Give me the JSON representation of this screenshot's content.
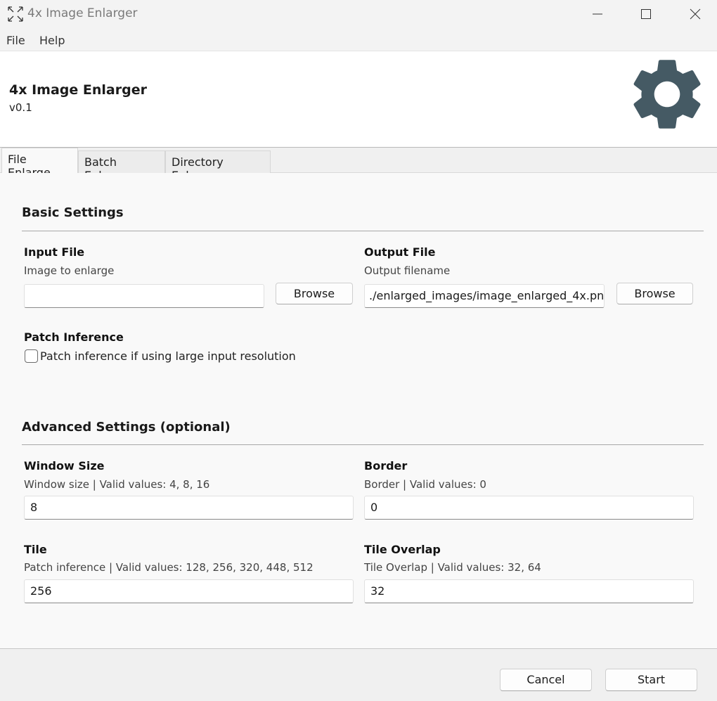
{
  "window": {
    "title": "4x Image Enlarger"
  },
  "menu": {
    "file": "File",
    "help": "Help"
  },
  "header": {
    "title": "4x Image Enlarger",
    "version": "v0.1",
    "icon": "gear-icon"
  },
  "tabs": [
    {
      "label": "File Enlarge",
      "active": true
    },
    {
      "label": "Batch Enlarge",
      "active": false
    },
    {
      "label": "Directory Enlarge",
      "active": false
    }
  ],
  "basic": {
    "title": "Basic Settings",
    "input_file": {
      "label": "Input File",
      "desc": "Image to enlarge",
      "value": "",
      "browse": "Browse"
    },
    "output_file": {
      "label": "Output File",
      "desc": "Output filename",
      "value": "./enlarged_images/image_enlarged_4x.pn",
      "browse": "Browse"
    },
    "patch": {
      "label": "Patch Inference",
      "checkbox_label": "Patch inference if using large input resolution",
      "checked": false
    }
  },
  "advanced": {
    "title": "Advanced Settings (optional)",
    "window_size": {
      "label": "Window Size",
      "desc": "Window size | Valid values: 4, 8, 16",
      "value": "8"
    },
    "border": {
      "label": "Border",
      "desc": "Border | Valid values: 0",
      "value": "0"
    },
    "tile": {
      "label": "Tile",
      "desc": "Patch inference | Valid values: 128, 256, 320, 448, 512",
      "value": "256"
    },
    "tile_overlap": {
      "label": "Tile Overlap",
      "desc": "Tile Overlap | Valid values: 32, 64",
      "value": "32"
    }
  },
  "footer": {
    "cancel": "Cancel",
    "start": "Start"
  },
  "colors": {
    "gear": "#455a64",
    "background": "#f9f9f9"
  }
}
